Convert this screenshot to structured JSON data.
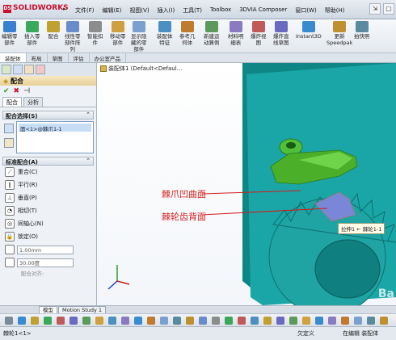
{
  "app": {
    "logo": "SOLIDWORKS",
    "logo_mark": "DS"
  },
  "menu": [
    "文件(F)",
    "编辑(E)",
    "视图(V)",
    "插入(I)",
    "工具(T)",
    "Toolbox",
    "3DVIA Composer",
    "窗口(W)",
    "帮助(H)"
  ],
  "toolbar": {
    "items": [
      {
        "label": "编辑零\n部件",
        "icon": "edit-component-icon",
        "color": "#3b7fd0"
      },
      {
        "label": "插入零\n部件",
        "icon": "insert-component-icon",
        "color": "#3aa85a"
      },
      {
        "label": "配合",
        "icon": "mate-icon",
        "color": "#c0a030"
      },
      {
        "label": "线性零\n部件阵\n列",
        "icon": "linear-pattern-icon",
        "color": "#6a8cc8"
      },
      {
        "label": "智能扣\n件",
        "icon": "smart-fastener-icon",
        "color": "#8c8c8c"
      },
      {
        "label": "移动零\n部件",
        "icon": "move-component-icon",
        "color": "#d0a040"
      },
      {
        "label": "显示隐\n藏的零\n部件",
        "icon": "show-hidden-icon",
        "color": "#7aa0d0"
      },
      {
        "label": "装配体\n特征",
        "icon": "assembly-feature-icon",
        "color": "#4a90c0"
      },
      {
        "label": "参考几\n何体",
        "icon": "reference-geometry-icon",
        "color": "#c07a30"
      },
      {
        "label": "新建运\n动算例",
        "icon": "new-motion-study-icon",
        "color": "#5a9a5a"
      },
      {
        "label": "材料明\n细表",
        "icon": "bom-icon",
        "color": "#8a7ac0"
      },
      {
        "label": "爆炸视\n图",
        "icon": "exploded-view-icon",
        "color": "#c05a5a"
      },
      {
        "label": "爆炸直\n线草图",
        "icon": "explode-line-sketch-icon",
        "color": "#6a6ac0"
      },
      {
        "label": "Instant3D",
        "icon": "instant3d-icon",
        "color": "#3a8ad0"
      },
      {
        "label": "更新\nSpeedpak",
        "icon": "speedpak-icon",
        "color": "#c09030"
      },
      {
        "label": "拍快照",
        "icon": "snapshot-icon",
        "color": "#5a8aa0"
      }
    ]
  },
  "cmd_tabs": [
    "装配体",
    "布局",
    "草图",
    "评估",
    "办公室产品"
  ],
  "property_manager": {
    "title": "配合",
    "ok": "✔",
    "cancel": "✖",
    "pin": "⊣",
    "subtabs": [
      "配合",
      "分析"
    ],
    "selection_group": "配合选择(S)",
    "selection_item": "面<1>@棘爪1-1",
    "standard_group": "标准配合(A)",
    "mates": [
      {
        "label": "重合(C)",
        "icon": "coincident-icon",
        "glyph": "⟋"
      },
      {
        "label": "平行(R)",
        "icon": "parallel-icon",
        "glyph": "∥"
      },
      {
        "label": "垂直(P)",
        "icon": "perpendicular-icon",
        "glyph": "⊥"
      },
      {
        "label": "相切(T)",
        "icon": "tangent-icon",
        "glyph": "◔"
      },
      {
        "label": "同轴心(N)",
        "icon": "concentric-icon",
        "glyph": "◎"
      },
      {
        "label": "锁定(O)",
        "icon": "lock-icon",
        "glyph": "🔒"
      }
    ],
    "distance_value": "1.00mm",
    "angle_value": "30.00度",
    "align_label": "配合对齐:"
  },
  "viewport": {
    "tree_tag": "装配体1 (Default<Defaul...",
    "callout": "拉伸1 ← 棘轮1-1",
    "annotation1": "棘爪凹曲面",
    "annotation2": "棘轮齿背面",
    "colors": {
      "body": "#1aa6a6",
      "body_dark": "#0f7a7a",
      "pawl": "#4caf2a",
      "gear": "#1fa3a3",
      "highlight": "#7a86d8"
    }
  },
  "model_tabs": [
    "模型",
    "Motion Study 1"
  ],
  "status": {
    "left": "棘轮1<1>",
    "mid": "欠定义",
    "right": "在编辑 装配体"
  },
  "watermark": "Ba"
}
